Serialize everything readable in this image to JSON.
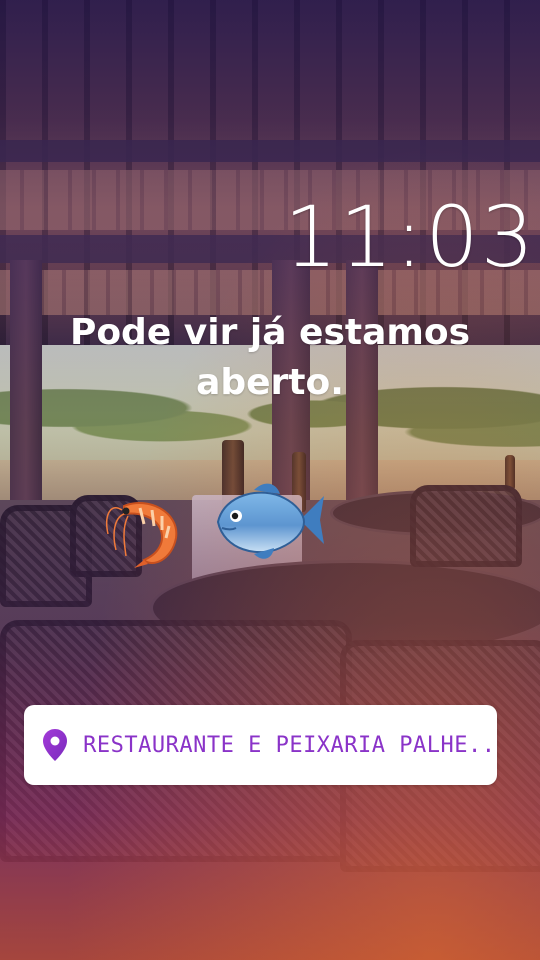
{
  "story": {
    "time": "11:03",
    "caption": "Pode vir já estamos aberto.",
    "stickers": [
      {
        "name": "shrimp",
        "icon": "shrimp-icon"
      },
      {
        "name": "fish",
        "icon": "fish-icon"
      }
    ],
    "location": {
      "icon": "location-pin-icon",
      "label": "RESTAURANTE E PEIXARIA PALHE..."
    }
  },
  "colors": {
    "location_text": "#8a33c8",
    "overlay_top": "#281460",
    "overlay_bottom": "#d2503c"
  }
}
